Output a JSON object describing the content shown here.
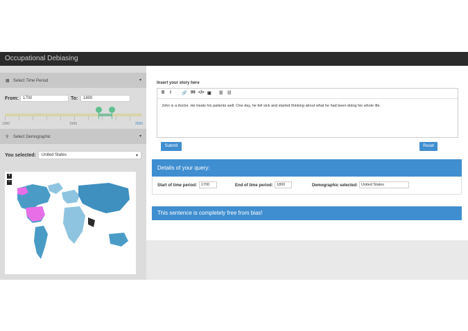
{
  "app": {
    "title": "Occupational Debiasing"
  },
  "sidebar": {
    "time_period": {
      "header": "Select Time Period",
      "from_label": "From:",
      "from_value": "1700",
      "to_label": "To:",
      "to_value": "1800",
      "slider": {
        "min": 1000,
        "max": 2000,
        "from": 1700,
        "to": 1800,
        "min_label": "1000",
        "mid_label": "1500",
        "max_label": "2000"
      }
    },
    "demographic": {
      "header": "Select Demographic",
      "selected_label": "You selected:",
      "selected_value": "United States"
    },
    "map": {
      "zoom_in": "+",
      "zoom_out": "−",
      "highlight_color": "#e86ee8",
      "base_color": "#4a9cc7"
    }
  },
  "main": {
    "story_label": "Insert your story here",
    "toolbar": {
      "bold": "B",
      "italic": "I",
      "link": "🔗",
      "quote": "99",
      "code": "</>",
      "image": "▣",
      "ul": "☰",
      "ol": "☷"
    },
    "story_text": "John is a doctor. He treats his patients well. One day, he fell sick and started thinking about what he had been doing his whole life.",
    "submit_label": "Submit",
    "reset_label": "Reset",
    "details": {
      "title": "Details of your query:",
      "start_label": "Start of time period:",
      "start_value": "1700",
      "end_label": "End of time period:",
      "end_value": "1800",
      "demo_label": "Demographic selected:",
      "demo_value": "United States"
    },
    "result": {
      "message": "This sentence is completely free from bias!"
    }
  },
  "colors": {
    "accent": "#3f8ed0",
    "topbar": "#2b2b2b",
    "slider_handle": "#5fbf8f"
  }
}
